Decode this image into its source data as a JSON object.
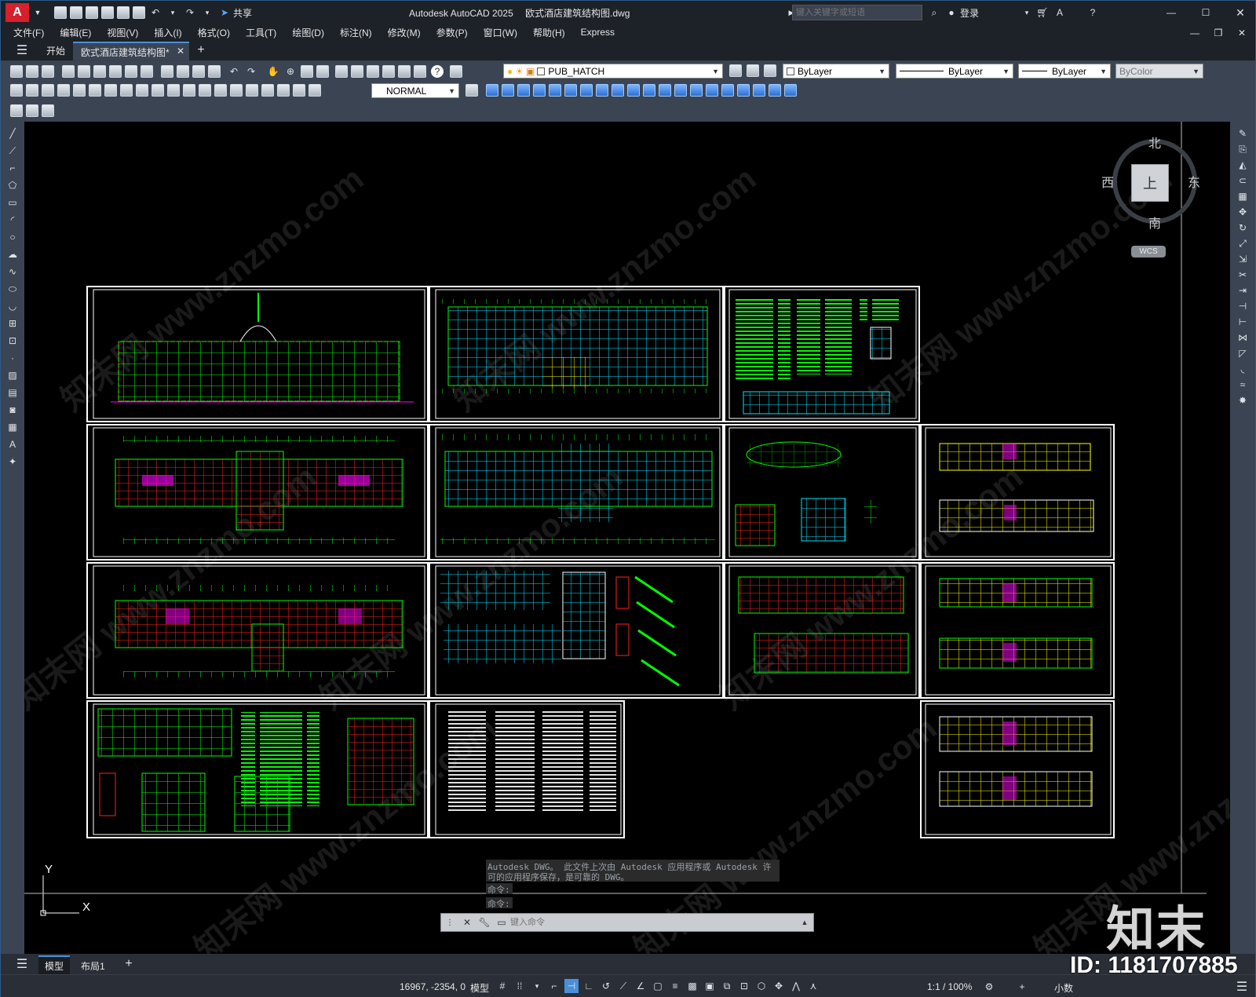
{
  "title": {
    "app_name": "Autodesk AutoCAD 2025",
    "filename": "欧式酒店建筑结构图.dwg",
    "share": "共享",
    "search_placeholder": "键入关键字或短语",
    "login": "登录"
  },
  "menu": [
    "文件(F)",
    "编辑(E)",
    "视图(V)",
    "插入(I)",
    "格式(O)",
    "工具(T)",
    "绘图(D)",
    "标注(N)",
    "修改(M)",
    "参数(P)",
    "窗口(W)",
    "帮助(H)",
    "Express"
  ],
  "tabs": {
    "start": "开始",
    "doc": "欧式酒店建筑结构图*"
  },
  "layer": {
    "current": "PUB_HATCH"
  },
  "properties": {
    "color": "ByLayer",
    "linetype": "ByLayer",
    "lineweight": "ByLayer",
    "plotstyle": "ByColor"
  },
  "dimstyle": "NORMAL",
  "viewcube": {
    "north": "北",
    "south": "南",
    "east": "东",
    "west": "西",
    "top": "上",
    "wcs": "WCS"
  },
  "ucs": {
    "x": "X",
    "y": "Y"
  },
  "command": {
    "history1": "Autodesk DWG。 此文件上次由 Autodesk 应用程序或 Autodesk 许",
    "history2": "可的应用程序保存，是可靠的 DWG。",
    "prompt1": "命令:",
    "prompt2": "命令:",
    "placeholder": "键入命令"
  },
  "layout_tabs": {
    "model": "模型",
    "layout1": "布局1"
  },
  "status": {
    "coords": "16967, -2354, 0",
    "space": "模型",
    "scale": "1:1 / 100%",
    "units": "小数"
  },
  "overlay": {
    "logo": "知末",
    "id_label": "ID: 1181707885",
    "watermark": "知末网 www.znzmo.com"
  }
}
